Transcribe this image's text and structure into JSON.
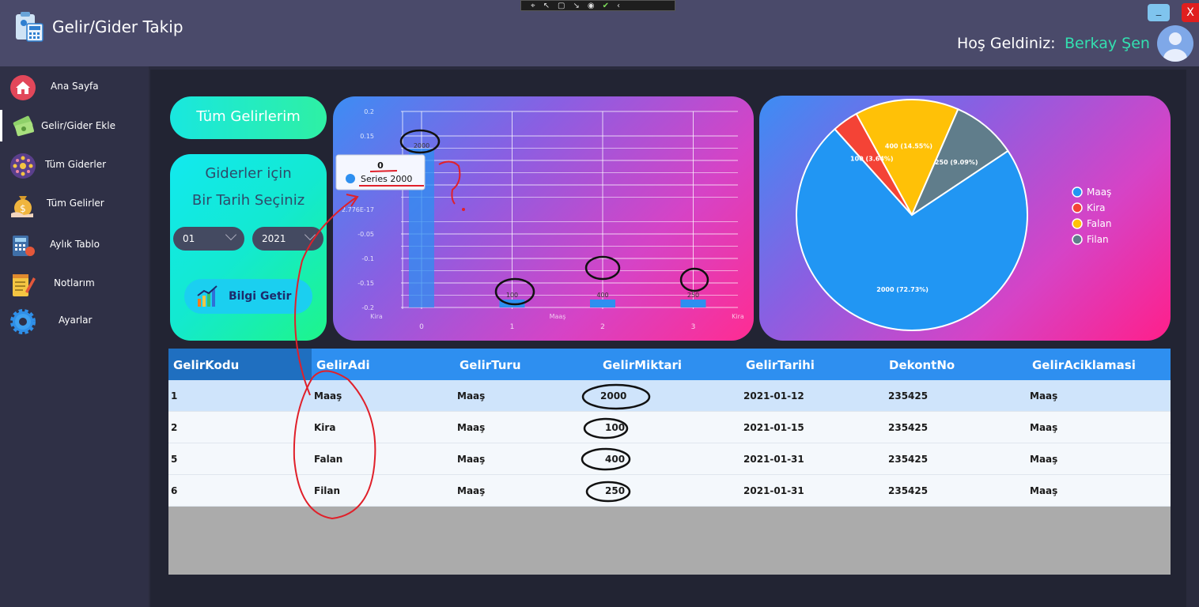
{
  "window": {
    "app_title": "Gelir/Gider Takip",
    "minimize_label": "_",
    "close_label": "X",
    "welcome_label": "Hoş Geldiniz:",
    "user_name": "Berkay Şen"
  },
  "sidebar": {
    "items": [
      {
        "label": "Ana Sayfa",
        "icon": "home-icon"
      },
      {
        "label": "Gelir/Gider Ekle",
        "icon": "money-icon"
      },
      {
        "label": "Tüm Giderler",
        "icon": "network-icon"
      },
      {
        "label": "Tüm Gelirler",
        "icon": "money-bag-icon"
      },
      {
        "label": "Aylık Tablo",
        "icon": "calculator-icon"
      },
      {
        "label": "Notlarım",
        "icon": "notepad-icon"
      },
      {
        "label": "Ayarlar",
        "icon": "gear-icon"
      }
    ]
  },
  "actions": {
    "all_income_label": "Tüm Gelirlerim",
    "date_card_title1": "Giderler için",
    "date_card_title2": "Bir Tarih Seçiniz",
    "month_value": "01",
    "year_value": "2021",
    "get_info_label": "Bilgi Getir"
  },
  "chart_data": [
    {
      "type": "bar",
      "categories": [
        "0",
        "1",
        "2",
        "3"
      ],
      "category_labels": [
        "Kira",
        "Maaş",
        "Kira"
      ],
      "values": [
        2000,
        100,
        400,
        250
      ],
      "data_labels": [
        "2000",
        "100",
        "400",
        "250"
      ],
      "y_ticks": [
        "0.2",
        "0.15",
        "0.1",
        "0.05",
        "-0.05",
        "-0.1",
        "-0.15",
        "-0.2"
      ],
      "partial_tick": "2.776E-17",
      "ylim": [
        -0.2,
        0.2
      ],
      "tooltip": {
        "value": "0",
        "series": "Series 2000"
      },
      "bar_color": "#2e8ff0"
    },
    {
      "type": "pie",
      "labels": [
        "Maaş",
        "Kira",
        "Falan",
        "Filan"
      ],
      "values": [
        2000,
        100,
        400,
        250
      ],
      "slice_labels": [
        "2000 (72.73%)",
        "100 (3.64%)",
        "400 (14.55%)",
        "250 (9.09%)"
      ],
      "colors": [
        "#2196f3",
        "#f44336",
        "#ffc107",
        "#607d8b"
      ],
      "legend": "right"
    }
  ],
  "table": {
    "columns": [
      "GelirKodu",
      "GelirAdi",
      "GelirTuru",
      "GelirMiktari",
      "GelirTarihi",
      "DekontNo",
      "GelirAciklamasi"
    ],
    "rows": [
      [
        "1",
        "Maaş",
        "Maaş",
        "2000",
        "2021-01-12",
        "235425",
        "Maaş"
      ],
      [
        "2",
        "Kira",
        "Maaş",
        "100",
        "2021-01-15",
        "235425",
        "Maaş"
      ],
      [
        "5",
        "Falan",
        "Maaş",
        "400",
        "2021-01-31",
        "235425",
        "Maaş"
      ],
      [
        "6",
        "Filan",
        "Maaş",
        "250",
        "2021-01-31",
        "235425",
        "Maaş"
      ]
    ],
    "selected_row": 0
  }
}
